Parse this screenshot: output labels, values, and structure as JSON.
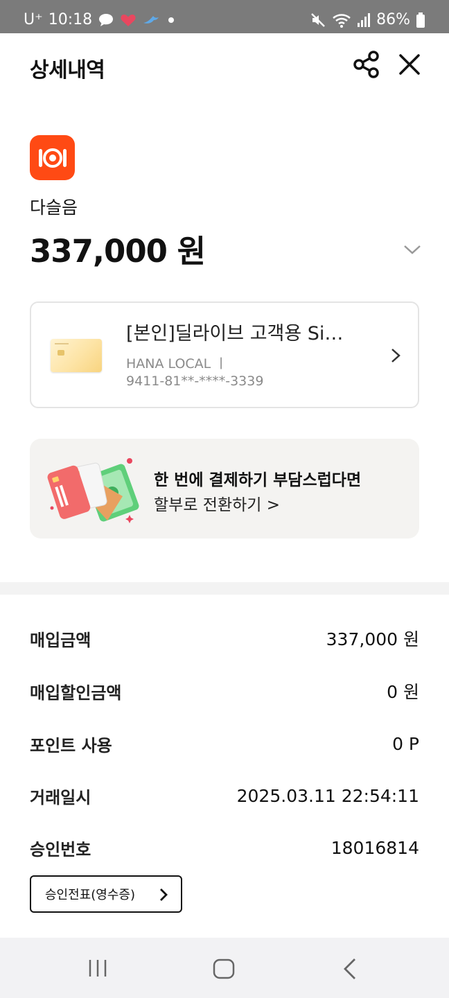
{
  "status_bar": {
    "carrier": "U⁺",
    "time": "10:18",
    "battery": "86%",
    "icons": [
      "chat-bubble-icon",
      "heart-icon",
      "bird-icon",
      "dot-icon",
      "mute-icon",
      "wifi-icon",
      "signal-icon",
      "battery-icon"
    ]
  },
  "header": {
    "title": "상세내역",
    "share_icon": "share-icon",
    "close_icon": "close-icon"
  },
  "merchant": {
    "icon": "restaurant-icon",
    "name": "다슬음",
    "amount": "337,000 원"
  },
  "card": {
    "name": "[본인]딜라이브 고객용 Si…",
    "brand": "HANA LOCAL  ㅣ",
    "number": "9411-81**-****-3339"
  },
  "banner": {
    "title": "한 번에 결제하기 부담스럽다면",
    "subtitle": "할부로 전환하기 >"
  },
  "details": [
    {
      "label": "매입금액",
      "value": "337,000 원"
    },
    {
      "label": "매입할인금액",
      "value": "0 원"
    },
    {
      "label": "포인트 사용",
      "value": "0 P"
    },
    {
      "label": "거래일시",
      "value": "2025.03.11 22:54:11"
    },
    {
      "label": "승인번호",
      "value": "18016814"
    }
  ],
  "receipt_button": {
    "label": "승인전표(영수증)"
  },
  "colors": {
    "accent": "#ff4a14",
    "banner_bg": "#f4f3f1",
    "status_bar_bg": "#7b7b7b"
  }
}
